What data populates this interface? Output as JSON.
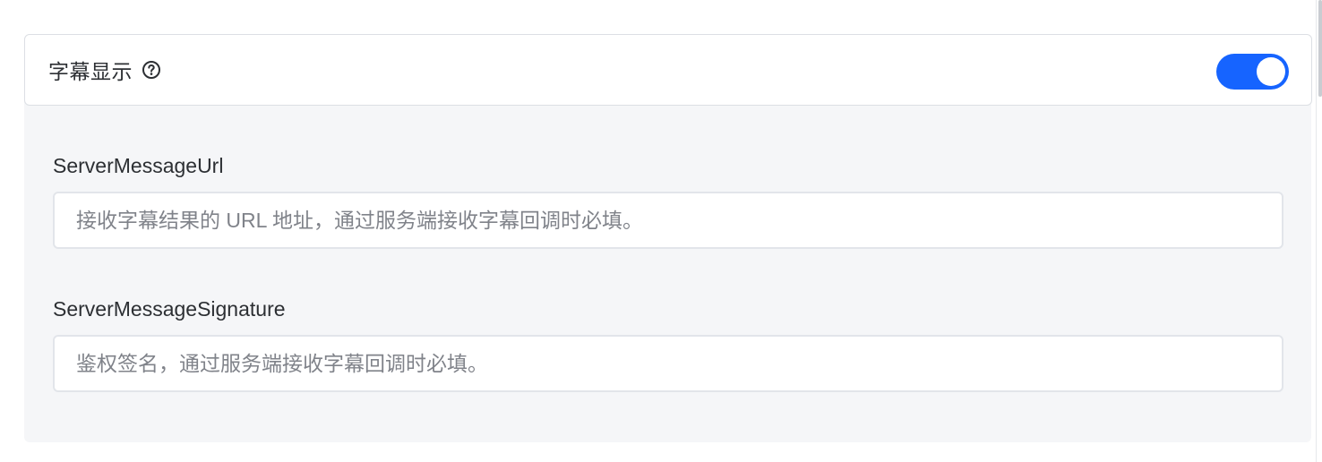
{
  "section": {
    "title": "字幕显示",
    "help_icon": "question-circle-icon",
    "toggle_on": true,
    "toggle_color": "#1664ff"
  },
  "fields": [
    {
      "label": "ServerMessageUrl",
      "value": "",
      "placeholder": "接收字幕结果的 URL 地址，通过服务端接收字幕回调时必填。"
    },
    {
      "label": "ServerMessageSignature",
      "value": "",
      "placeholder": "鉴权签名，通过服务端接收字幕回调时必填。"
    }
  ]
}
